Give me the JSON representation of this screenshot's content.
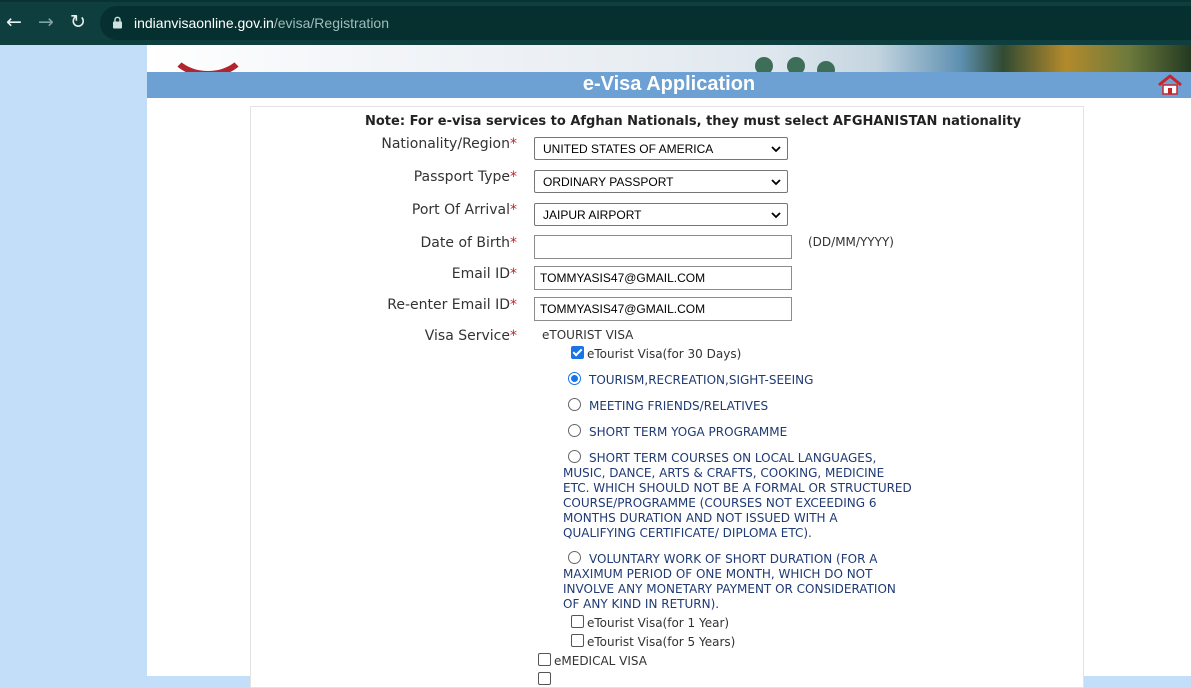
{
  "browser": {
    "url_host": "indianvisaonline.gov.in",
    "url_path": "/evisa/Registration"
  },
  "page": {
    "title": "e-Visa Application",
    "note": "Note: For e-visa services to Afghan Nationals, they must select AFGHANISTAN nationality"
  },
  "form": {
    "nationality": {
      "label": "Nationality/Region",
      "value": "UNITED STATES OF AMERICA"
    },
    "passport_type": {
      "label": "Passport Type",
      "value": "ORDINARY PASSPORT"
    },
    "port_of_arrival": {
      "label": "Port Of Arrival",
      "value": "JAIPUR AIRPORT"
    },
    "date_of_birth": {
      "label": "Date of Birth",
      "value": "",
      "hint": "(DD/MM/YYYY)"
    },
    "email": {
      "label": "Email ID",
      "value": "TOMMYASIS47@GMAIL.COM"
    },
    "email_confirm": {
      "label": "Re-enter Email ID",
      "value": "TOMMYASIS47@GMAIL.COM"
    },
    "required_mark": "*",
    "visa_service": {
      "label": "Visa Service",
      "group_title": "eTOURIST VISA",
      "etourist_30": "eTourist Visa(for 30 Days)",
      "purposes": [
        "TOURISM,RECREATION,SIGHT-SEEING",
        "MEETING FRIENDS/RELATIVES",
        "SHORT TERM YOGA PROGRAMME",
        "SHORT TERM COURSES ON LOCAL LANGUAGES, MUSIC, DANCE, ARTS & CRAFTS, COOKING, MEDICINE ETC. WHICH SHOULD NOT BE A FORMAL OR STRUCTURED COURSE/PROGRAMME (COURSES NOT EXCEEDING 6 MONTHS DURATION AND NOT ISSUED WITH A QUALIFYING CERTIFICATE/ DIPLOMA ETC).",
        "VOLUNTARY WORK OF SHORT DURATION (FOR A MAXIMUM PERIOD OF ONE MONTH, WHICH DO NOT INVOLVE ANY MONETARY PAYMENT OR CONSIDERATION OF ANY KIND IN RETURN)."
      ],
      "selected_purpose": "TOURISM,RECREATION,SIGHT-SEEING",
      "etourist_1y": "eTourist Visa(for 1 Year)",
      "etourist_5y": "eTourist Visa(for 5 Years)",
      "emedical": "eMEDICAL VISA",
      "etourist_30_checked": true
    }
  },
  "colors": {
    "title_bar": "#6da1d4",
    "required": "#c0242b",
    "purpose_text": "#1f3a74",
    "accent": "#1a73e8"
  }
}
